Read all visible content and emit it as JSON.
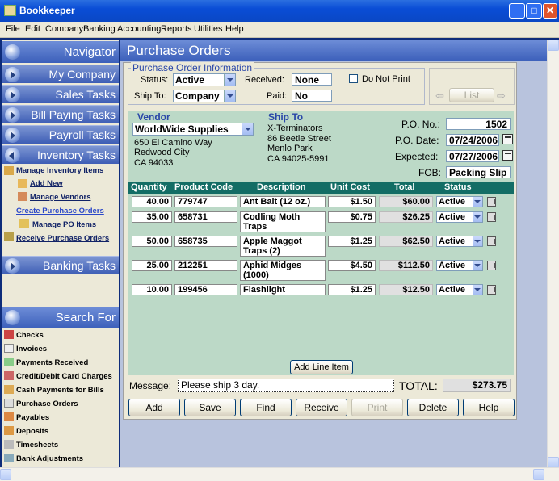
{
  "window": {
    "title": "Bookkeeper"
  },
  "menu": [
    "File",
    "Edit",
    "Company",
    "Banking",
    "Accounting",
    "Reports",
    "Utilities",
    "Help"
  ],
  "navigator": {
    "title": "Navigator",
    "buttons": [
      "My Company",
      "Sales Tasks",
      "Bill Paying Tasks",
      "Payroll Tasks",
      "Inventory Tasks"
    ],
    "inventory_links": [
      "Manage Inventory Items",
      "Add New",
      "Manage Vendors",
      "Create Purchase Orders",
      "Manage PO Items",
      "Receive Purchase Orders"
    ],
    "banking": "Banking Tasks"
  },
  "search": {
    "title": "Search For",
    "items": [
      "Checks",
      "Invoices",
      "Payments Received",
      "Credit/Debit Card Charges",
      "Cash Payments for Bills",
      "Purchase Orders",
      "Payables",
      "Deposits",
      "Timesheets",
      "Bank Adjustments"
    ]
  },
  "page_title": "Purchase Orders",
  "po_info": {
    "legend": "Purchase Order Information",
    "status_label": "Status:",
    "status_value": "Active",
    "shipto_label": "Ship To:",
    "shipto_value": "Company",
    "received_label": "Received:",
    "received_value": "None",
    "paid_label": "Paid:",
    "paid_value": "No",
    "do_not_print": "Do Not Print",
    "list_button": "List"
  },
  "vendor": {
    "label": "Vendor",
    "name": "WorldWide Supplies",
    "address1": "650 El Camino Way",
    "address2": "Redwood City",
    "address3": "CA  94033"
  },
  "ship_to": {
    "label": "Ship To",
    "name": "X-Terminators",
    "address1": "86 Beetle Street",
    "address2": "Menlo Park",
    "address3": "CA  94025-5991"
  },
  "po_details": {
    "po_no_label": "P.O. No.:",
    "po_no": "1502",
    "po_date_label": "P.O. Date:",
    "po_date": "07/24/2006",
    "expected_label": "Expected:",
    "expected": "07/27/2006",
    "fob_label": "FOB:",
    "fob": "Packing Slip"
  },
  "table": {
    "headers": [
      "Quantity",
      "Product Code",
      "Description",
      "Unit Cost",
      "Total",
      "Status"
    ],
    "rows": [
      {
        "qty": "40.00",
        "code": "779747",
        "desc": "Ant Bait (12 oz.)",
        "unit": "$1.50",
        "total": "$60.00",
        "status": "Active"
      },
      {
        "qty": "35.00",
        "code": "658731",
        "desc": "Codling Moth Traps",
        "unit": "$0.75",
        "total": "$26.25",
        "status": "Active"
      },
      {
        "qty": "50.00",
        "code": "658735",
        "desc": "Apple Maggot Traps (2)",
        "unit": "$1.25",
        "total": "$62.50",
        "status": "Active"
      },
      {
        "qty": "25.00",
        "code": "212251",
        "desc": "Aphid Midges (1000)",
        "unit": "$4.50",
        "total": "$112.50",
        "status": "Active"
      },
      {
        "qty": "10.00",
        "code": "199456",
        "desc": "Flashlight",
        "unit": "$1.25",
        "total": "$12.50",
        "status": "Active"
      }
    ],
    "add_line": "Add Line Item"
  },
  "footer": {
    "message_label": "Message:",
    "message": "Please ship 3 day.",
    "total_label": "TOTAL:",
    "total": "$273.75"
  },
  "buttons": [
    "Add",
    "Save",
    "Find",
    "Receive",
    "Print",
    "Delete",
    "Help"
  ]
}
